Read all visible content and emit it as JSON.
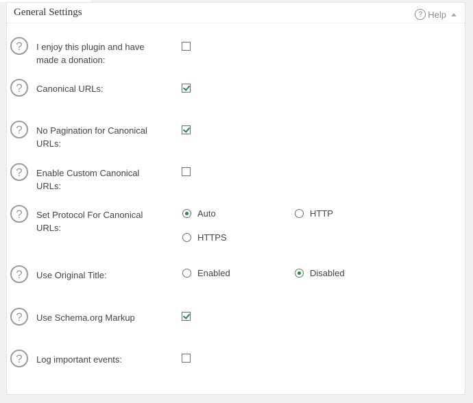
{
  "panel": {
    "title": "General Settings",
    "help_label": "Help"
  },
  "settings": {
    "donation": {
      "label": "I enjoy this plugin and have made a donation:",
      "checked": false
    },
    "canonical_urls": {
      "label": "Canonical URLs:",
      "checked": true
    },
    "no_pagination": {
      "label": "No Pagination for Canonical URLs:",
      "checked": true
    },
    "custom_canonical": {
      "label": "Enable Custom Canonical URLs:",
      "checked": false
    },
    "protocol": {
      "label": "Set Protocol For Canonical URLs:",
      "options": [
        "Auto",
        "HTTP",
        "HTTPS"
      ],
      "selected": "Auto"
    },
    "original_title": {
      "label": "Use Original Title:",
      "options": [
        "Enabled",
        "Disabled"
      ],
      "selected": "Disabled"
    },
    "schema_markup": {
      "label": "Use Schema.org Markup",
      "checked": true
    },
    "log_events": {
      "label": "Log important events:",
      "checked": false
    }
  },
  "icons": {
    "help": "question-mark-circle-icon",
    "collapse": "caret-up-icon"
  },
  "colors": {
    "check": "#1e8e3e",
    "border": "#6e6e6e",
    "icon": "#9a9a9a"
  }
}
